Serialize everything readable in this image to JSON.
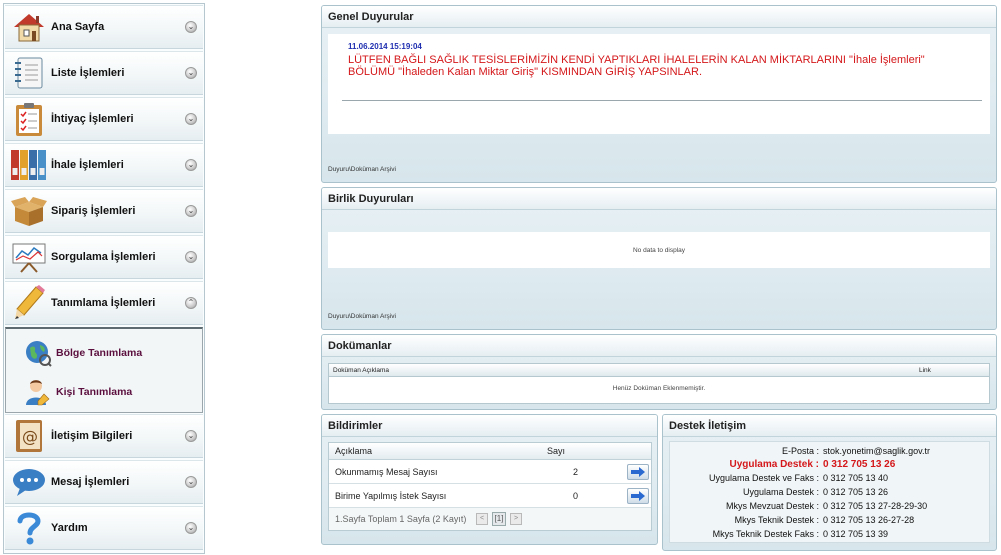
{
  "sidebar": {
    "items": [
      {
        "label": "Ana Sayfa",
        "icon": "house-icon",
        "expander": "⌄"
      },
      {
        "label": "Liste İşlemleri",
        "icon": "notebook-icon",
        "expander": "⌄"
      },
      {
        "label": "İhtiyaç İşlemleri",
        "icon": "clipboard-checklist-icon",
        "expander": "⌄"
      },
      {
        "label": "İhale İşlemleri",
        "icon": "binders-icon",
        "expander": "⌄"
      },
      {
        "label": "Sipariş İşlemleri",
        "icon": "open-box-icon",
        "expander": "⌄"
      },
      {
        "label": "Sorgulama İşlemleri",
        "icon": "chart-easel-icon",
        "expander": "⌄"
      },
      {
        "label": "Tanımlama İşlemleri",
        "icon": "pencil-icon",
        "expander": "⌃"
      },
      {
        "label": "İletişim Bilgileri",
        "icon": "address-book-icon",
        "expander": "⌄"
      },
      {
        "label": "Mesaj İşlemleri",
        "icon": "speech-bubble-icon",
        "expander": "⌄"
      },
      {
        "label": "Yardım",
        "icon": "question-mark-icon",
        "expander": "⌄"
      }
    ],
    "subitems": [
      {
        "label": "Bölge Tanımlama",
        "icon": "globe-icon"
      },
      {
        "label": "Kişi Tanımlama",
        "icon": "person-edit-icon"
      }
    ]
  },
  "announcements": {
    "title": "Genel Duyurular",
    "date": "11.06.2014 15:19:04",
    "message": "LÜTFEN BAĞLI SAĞLIK TESİSLERİMİZİN KENDİ YAPTIKLARI İHALELERİN KALAN MİKTARLARINI \"İhale İşlemleri\" BÖLÜMÜ \"İhaleden Kalan Miktar Giriş\" KISMINDAN GİRİŞ YAPSINLAR.",
    "archive_link": "Duyuru\\Doküman Arşivi"
  },
  "union_announcements": {
    "title": "Birlik Duyuruları",
    "empty_text": "No data to display",
    "archive_link": "Duyuru\\Doküman Arşivi"
  },
  "documents": {
    "title": "Dokümanlar",
    "col_description": "Doküman Açıklama",
    "col_link": "Link",
    "empty_text": "Henüz Doküman Eklenmemiştir."
  },
  "notifications": {
    "title": "Bildirimler",
    "col_description": "Açıklama",
    "col_count": "Sayı",
    "rows": [
      {
        "label": "Okunmamış Mesaj Sayısı",
        "count": "2"
      },
      {
        "label": "Birime Yapılmış İstek Sayısı",
        "count": "0"
      }
    ],
    "pager_text": "1.Sayfa Toplam 1 Sayfa (2 Kayıt)",
    "pager_prev": "<",
    "pager_current": "[1]",
    "pager_next": ">"
  },
  "support": {
    "title": "Destek İletişim",
    "email_label": "E-Posta :",
    "email_value": "stok.yonetim@saglik.gov.tr",
    "app_support_label": "Uygulama Destek :",
    "app_support_value": "0 312 705 13 26",
    "lines": [
      {
        "label": "Uygulama Destek ve Faks :",
        "value": "0 312 705 13 40"
      },
      {
        "label": "Uygulama Destek :",
        "value": "0 312 705 13 26"
      },
      {
        "label": "Mkys Mevzuat Destek :",
        "value": "0 312 705 13 27-28-29-30"
      },
      {
        "label": "Mkys Teknik Destek :",
        "value": "0 312 705 13 26-27-28"
      },
      {
        "label": "Mkys Teknik Destek Faks :",
        "value": "0 312 705 13 39"
      }
    ]
  },
  "colors": {
    "highlight_red": "#d4171a",
    "date_blue": "#1f2fb0",
    "sub_item_text": "#5a0f3e"
  }
}
